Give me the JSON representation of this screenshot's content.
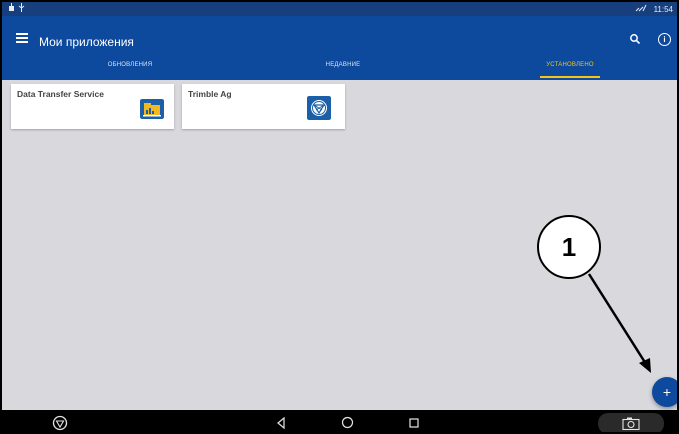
{
  "status_bar": {
    "left_icons": [
      "notification-icon",
      "usb-icon"
    ],
    "signal_icon": "signal-icon",
    "time": "11:54"
  },
  "app_bar": {
    "title": "Мои приложения",
    "menu_icon": "menu-icon",
    "search_icon": "search-icon",
    "info_icon": "info-icon",
    "tabs": [
      {
        "label": "ОБНОВЛЕНИЯ",
        "active": false
      },
      {
        "label": "НЕДАВНИЕ",
        "active": false
      },
      {
        "label": "УСТАНОВЛЕНО",
        "active": true
      }
    ],
    "accent_color": "#f5c518",
    "bar_color": "#0d4a9e"
  },
  "apps": [
    {
      "name": "Data Transfer Service",
      "icon": "data-transfer-icon"
    },
    {
      "name": "Trimble Ag",
      "icon": "trimble-icon"
    }
  ],
  "fab": {
    "label": "+",
    "icon": "add-icon"
  },
  "annotation": {
    "label": "1"
  },
  "nav_bar": {
    "icons": [
      "trimble-logo-icon",
      "back-icon",
      "home-icon",
      "recents-icon",
      "camera-icon"
    ]
  }
}
